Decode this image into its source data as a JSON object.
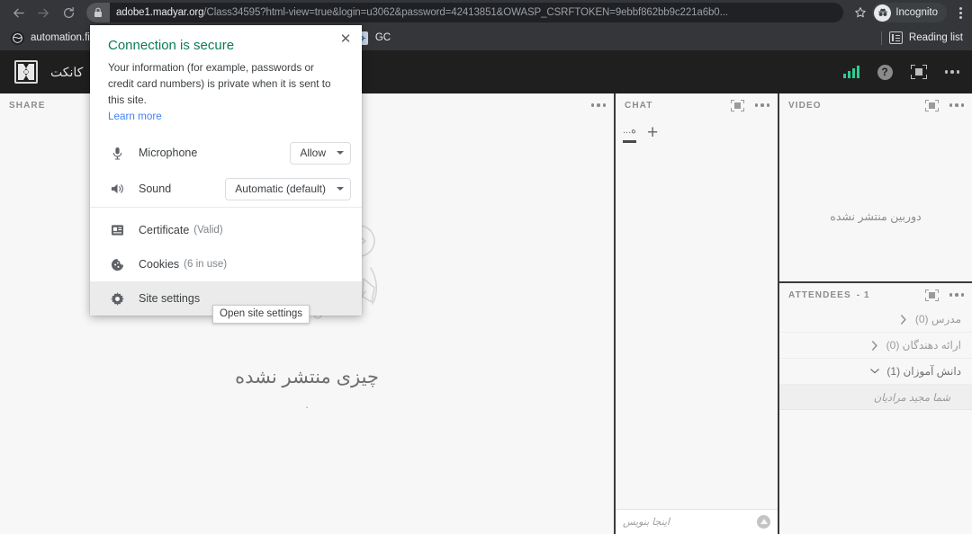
{
  "browser": {
    "nav": {
      "back_icon": "arrow-left-icon",
      "forward_icon": "arrow-right-icon",
      "reload_icon": "reload-icon"
    },
    "omnibox": {
      "lock_icon": "lock-icon",
      "url_host": "adobe1.madyar.org",
      "url_path": "/Class34595?html-view=true&login=u3062&password=42413851&OWASP_CSRFTOKEN=9ebbf862bb9c221a6b0...",
      "star_icon": "star-icon"
    },
    "incognito": {
      "label": "Incognito",
      "icon": "incognito-icon"
    },
    "menu_icon": "kebab-menu-icon",
    "bookmarks": [
      {
        "label": "automation.fi",
        "icon": "globe-icon"
      },
      {
        "label": "GC",
        "icon": "app-icon"
      }
    ],
    "reading_list": {
      "label": "Reading list",
      "icon": "reading-list-icon"
    }
  },
  "site_popup": {
    "close_icon": "close-icon",
    "heading": "Connection is secure",
    "description": "Your information (for example, passwords or credit card numbers) is private when it is sent to this site.",
    "learn_more": "Learn more",
    "permissions": [
      {
        "icon": "microphone-icon",
        "label": "Microphone",
        "value": "Allow"
      },
      {
        "icon": "sound-icon",
        "label": "Sound",
        "value": "Automatic (default)"
      }
    ],
    "items": [
      {
        "icon": "certificate-icon",
        "label": "Certificate",
        "sub": "(Valid)",
        "highlight": false
      },
      {
        "icon": "cookie-icon",
        "label": "Cookies",
        "sub": "(6 in use)",
        "highlight": false
      },
      {
        "icon": "gear-icon",
        "label": "Site settings",
        "sub": "",
        "highlight": true
      }
    ],
    "tooltip": "Open site settings"
  },
  "app": {
    "title": "کانکت",
    "logo_icon": "adobe-connect-logo-icon",
    "topbar_icons": {
      "signal_icon": "signal-bars-icon",
      "help_icon": "help-icon",
      "fullscreen_icon": "fullscreen-icon",
      "more_icon": "more-options-icon"
    },
    "share_pod": {
      "title": "SHARE",
      "more_icon": "more-options-icon",
      "empty_message": "چیزی منتشر نشده",
      "art_icon": "share-empty-illustration"
    },
    "chat_pod": {
      "title": "CHAT",
      "fullscreen_icon": "fullscreen-icon",
      "more_icon": "more-options-icon",
      "tab_label": "ه...",
      "add_tab_label": "+",
      "input_placeholder": "اینجا بنویس",
      "send_icon": "send-icon"
    },
    "video_pod": {
      "title": "VIDEO",
      "fullscreen_icon": "fullscreen-icon",
      "more_icon": "more-options-icon",
      "empty_message": "دوربین منتشر نشده"
    },
    "attendees_pod": {
      "title": "ATTENDEES",
      "count_label": "- 1",
      "fullscreen_icon": "fullscreen-icon",
      "more_icon": "more-options-icon",
      "groups": [
        {
          "label": "مدرس (0)",
          "expanded": false,
          "arrow_icon": "chevron-right-icon"
        },
        {
          "label": "ارائه دهندگان (0)",
          "expanded": false,
          "arrow_icon": "chevron-right-icon"
        },
        {
          "label": "دانش آموزان (1)",
          "expanded": true,
          "arrow_icon": "chevron-down-icon"
        }
      ],
      "members": [
        {
          "label": "شما  مجید مرادیان"
        }
      ]
    }
  },
  "colors": {
    "chrome_toolbar": "#35363a",
    "app_topbar": "#1f1f1f",
    "pod_bg": "#f7f7f7",
    "secure_green": "#0b7d52",
    "link_blue": "#4285f4",
    "signal_green": "#2ecc8f"
  }
}
